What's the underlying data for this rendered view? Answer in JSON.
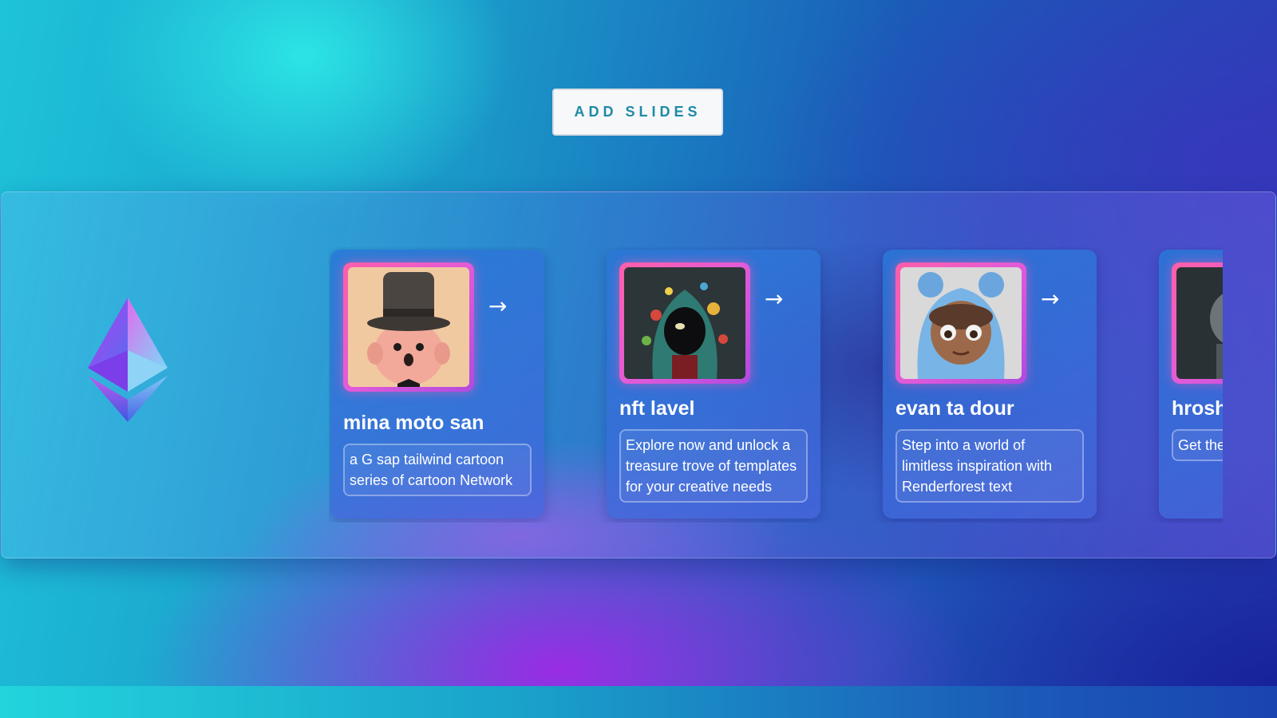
{
  "toolbar": {
    "add_slides_label": "ADD SLIDES"
  },
  "logo": {
    "icon": "ethereum-diamond-icon"
  },
  "slides": [
    {
      "name": "mina moto san",
      "description": "a G sap tailwind cartoon series of cartoon Network",
      "arrow": "→",
      "image": "top-hat-cartoon-character"
    },
    {
      "name": "nft lavel",
      "description": "Explore now and unlock a treasure trove of templates for your creative needs",
      "arrow": "→",
      "image": "hooded-creature-with-orbs"
    },
    {
      "name": "evan ta dour",
      "description": "Step into a world of limitless inspiration with Renderforest text",
      "arrow": "→",
      "image": "boy-in-bear-hoodie"
    },
    {
      "name": "hroshi",
      "description": "Get the services pfp",
      "arrow": "→",
      "image": "robot-figure"
    }
  ],
  "colors": {
    "accent_text": "#1f8aa6",
    "thumb_border": "#ff5fa8"
  }
}
